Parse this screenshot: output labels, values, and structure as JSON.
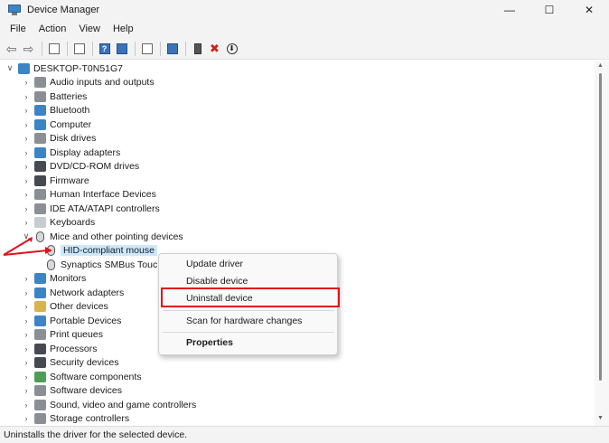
{
  "window": {
    "title": "Device Manager",
    "controls": {
      "minimize": "—",
      "maximize": "☐",
      "close": "✕"
    }
  },
  "menu": [
    "File",
    "Action",
    "View",
    "Help"
  ],
  "toolbar": {
    "icons": [
      "back-icon",
      "forward-icon",
      "properties-pane-icon",
      "properties-icon",
      "help-icon",
      "update-driver-icon",
      "scan-icon",
      "monitor-icon",
      "add-driver-icon",
      "uninstall-icon",
      "download-icon"
    ]
  },
  "tree": {
    "root": "DESKTOP-T0N51G7",
    "items": [
      {
        "label": "Audio inputs and outputs",
        "icon": "speaker-icon",
        "color": "c-gray"
      },
      {
        "label": "Batteries",
        "icon": "battery-icon",
        "color": "c-gray"
      },
      {
        "label": "Bluetooth",
        "icon": "bluetooth-icon",
        "color": "c-blue"
      },
      {
        "label": "Computer",
        "icon": "computer-icon",
        "color": "c-blue"
      },
      {
        "label": "Disk drives",
        "icon": "disk-icon",
        "color": "c-gray"
      },
      {
        "label": "Display adapters",
        "icon": "display-icon",
        "color": "c-blue"
      },
      {
        "label": "DVD/CD-ROM drives",
        "icon": "dvd-icon",
        "color": "c-dark"
      },
      {
        "label": "Firmware",
        "icon": "chip-icon",
        "color": "c-dark"
      },
      {
        "label": "Human Interface Devices",
        "icon": "hid-icon",
        "color": "c-gray"
      },
      {
        "label": "IDE ATA/ATAPI controllers",
        "icon": "ide-icon",
        "color": "c-gray"
      },
      {
        "label": "Keyboards",
        "icon": "keyboard-icon",
        "color": "c-light"
      },
      {
        "label": "Mice and other pointing devices",
        "icon": "mouse-icon",
        "color": "mouse",
        "expanded": true
      },
      {
        "label": "HID-compliant mouse",
        "icon": "mouse-icon",
        "color": "mouse",
        "child": true,
        "selected": true
      },
      {
        "label": "Synaptics SMBus Touc",
        "icon": "mouse-icon",
        "color": "mouse",
        "child": true
      },
      {
        "label": "Monitors",
        "icon": "monitor-icon",
        "color": "c-blue"
      },
      {
        "label": "Network adapters",
        "icon": "network-icon",
        "color": "c-blue"
      },
      {
        "label": "Other devices",
        "icon": "other-device-icon",
        "color": "c-yellow"
      },
      {
        "label": "Portable Devices",
        "icon": "portable-icon",
        "color": "c-blue"
      },
      {
        "label": "Print queues",
        "icon": "printer-icon",
        "color": "c-gray"
      },
      {
        "label": "Processors",
        "icon": "processor-icon",
        "color": "c-dark"
      },
      {
        "label": "Security devices",
        "icon": "security-icon",
        "color": "c-dark"
      },
      {
        "label": "Software components",
        "icon": "software-component-icon",
        "color": "c-green"
      },
      {
        "label": "Software devices",
        "icon": "software-device-icon",
        "color": "c-gray"
      },
      {
        "label": "Sound, video and game controllers",
        "icon": "sound-icon",
        "color": "c-gray"
      },
      {
        "label": "Storage controllers",
        "icon": "storage-icon",
        "color": "c-gray"
      }
    ]
  },
  "context_menu": {
    "update": "Update driver",
    "disable": "Disable device",
    "uninstall": "Uninstall device",
    "scan": "Scan for hardware changes",
    "properties": "Properties"
  },
  "status": "Uninstalls the driver for the selected device.",
  "colors": {
    "highlight": "#e0121c",
    "selection": "#cce8ff"
  }
}
